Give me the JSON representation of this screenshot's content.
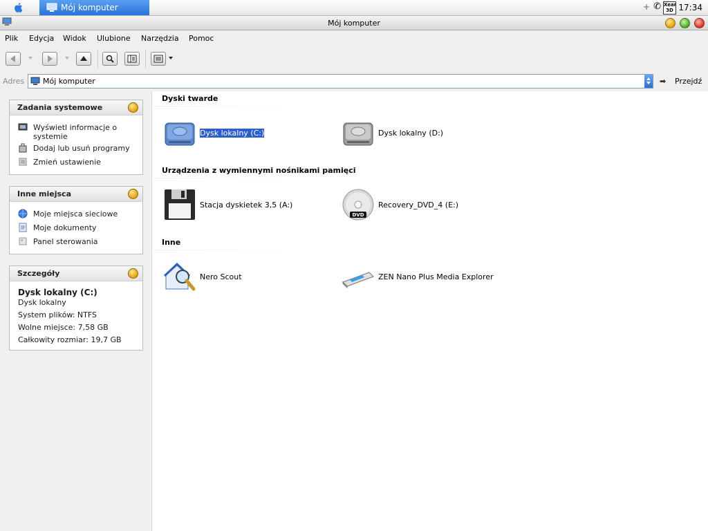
{
  "taskbar": {
    "active_task": "Mój komputer",
    "clock": "17:34",
    "tray_badge": "Xear 3D"
  },
  "window": {
    "title": "Mój komputer"
  },
  "menu": [
    "Plik",
    "Edycja",
    "Widok",
    "Ulubione",
    "Narzędzia",
    "Pomoc"
  ],
  "address": {
    "label": "Adres",
    "value": "Mój komputer",
    "go_label": "Przejdź"
  },
  "panels": {
    "system_tasks": {
      "title": "Zadania systemowe",
      "items": [
        "Wyświetl informacje o systemie",
        "Dodaj lub usuń programy",
        "Zmień ustawienie"
      ]
    },
    "other_places": {
      "title": "Inne miejsca",
      "items": [
        "Moje miejsca sieciowe",
        "Moje dokumenty",
        "Panel sterowania"
      ]
    },
    "details": {
      "title": "Szczegóły",
      "name": "Dysk lokalny (C:)",
      "type": "Dysk lokalny",
      "filesystem": "System plików: NTFS",
      "free_space": "Wolne miejsce: 7,58 GB",
      "total_size": "Całkowity rozmiar: 19,7 GB"
    }
  },
  "groups": {
    "hard_drives": {
      "title": "Dyski twarde",
      "items": [
        {
          "label": "Dysk lokalny (C:)",
          "icon": "hard-drive-blue-icon",
          "selected": true
        },
        {
          "label": "Dysk lokalny (D:)",
          "icon": "hard-drive-gray-icon"
        }
      ]
    },
    "removable": {
      "title": "Urządzenia z wymiennymi nośnikami pamięci",
      "items": [
        {
          "label": "Stacja dyskietek 3,5 (A:)",
          "icon": "floppy-disk-icon"
        },
        {
          "label": "Recovery_DVD_4 (E:)",
          "icon": "dvd-drive-icon"
        }
      ]
    },
    "other": {
      "title": "Inne",
      "items": [
        {
          "label": "Nero Scout",
          "icon": "nero-scout-icon"
        },
        {
          "label": "ZEN Nano Plus Media Explorer",
          "icon": "media-player-icon"
        }
      ]
    }
  },
  "colors": {
    "selection": "#2c5fcc",
    "task_active": "#2a73d8"
  }
}
